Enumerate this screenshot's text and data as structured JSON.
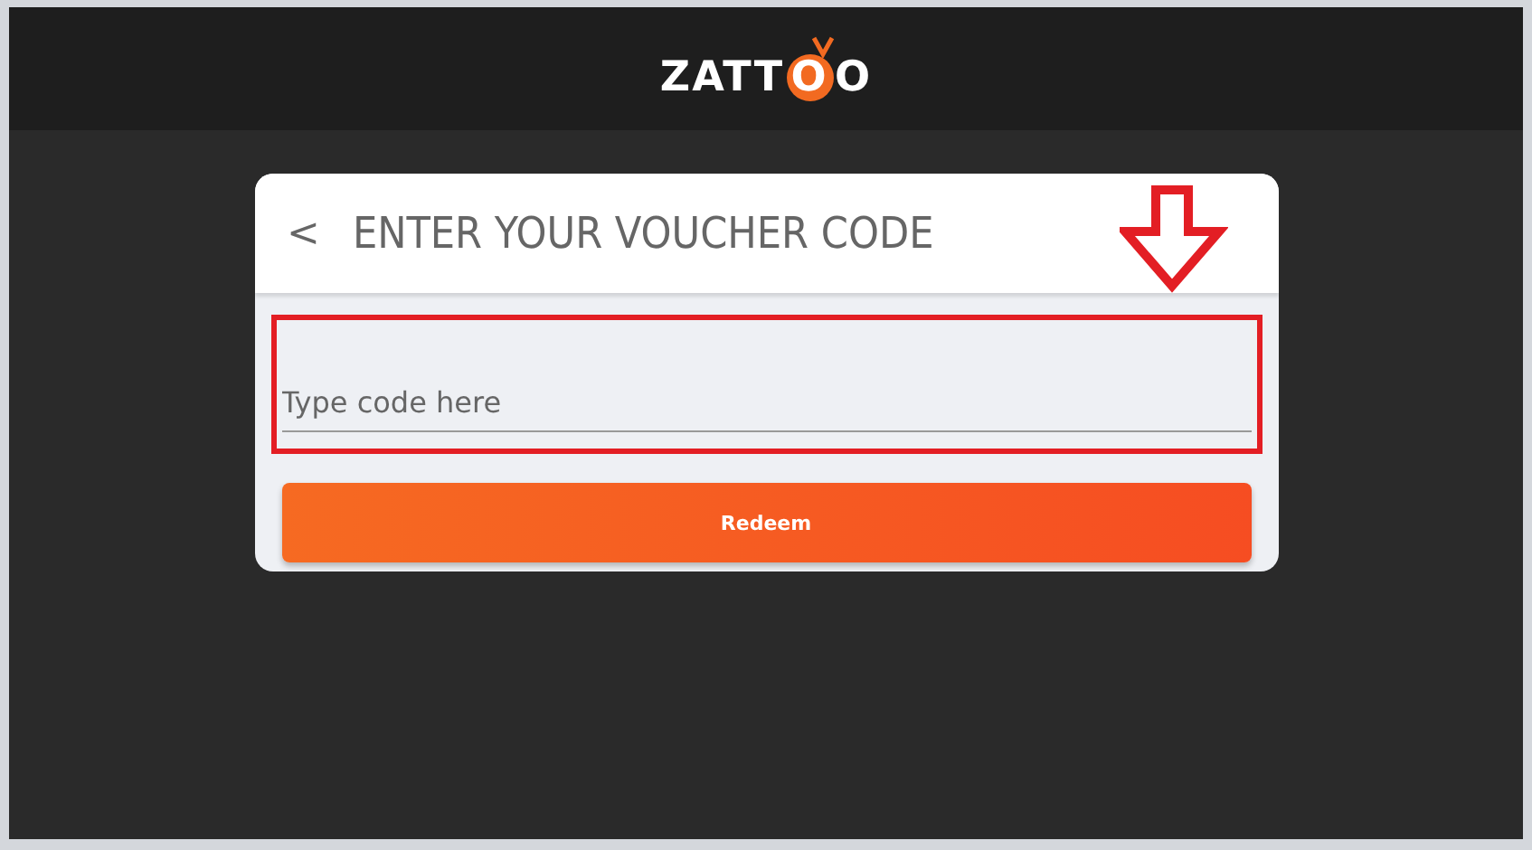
{
  "header": {
    "logo": "ZATTOO"
  },
  "card": {
    "back": "<",
    "title": "ENTER YOUR VOUCHER CODE",
    "code_field": {
      "placeholder": "Type code here",
      "highlighted": true
    },
    "redeem_button": "Redeem"
  },
  "annotation": {
    "arrow": true
  }
}
